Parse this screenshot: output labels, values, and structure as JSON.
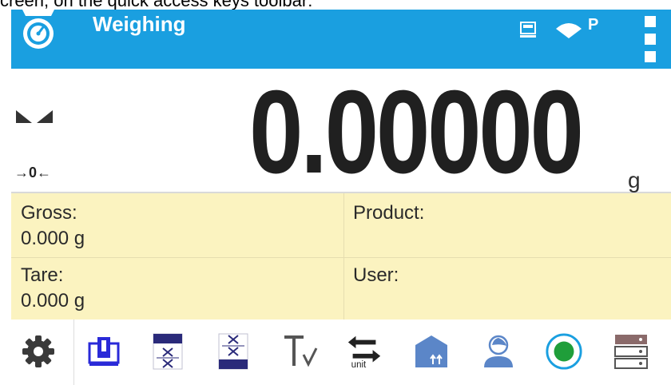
{
  "caption": "creen, on the quick access keys toolbar:",
  "titlebar": {
    "title": "Weighing",
    "icons": [
      "scale-app-icon",
      "pc-connection-icon",
      "wifi-icon",
      "menu-icon"
    ],
    "profile_letter": "P",
    "background": "#1a9fe0"
  },
  "display": {
    "weight": "0.00000",
    "unit": "g",
    "zero_indicator": "→0←",
    "stability_icon": "stable-indicator-icon"
  },
  "info": {
    "gross_label": "Gross:",
    "gross_value": "0.000 g",
    "product_label": "Product:",
    "tare_label": "Tare:",
    "tare_value": "0.000 g",
    "user_label": "User:",
    "background": "#fbf3c0"
  },
  "toolbar": {
    "unit_label": "unit",
    "keys": [
      "settings-icon",
      "tare-icon",
      "print-header-icon",
      "print-footer-icon",
      "text-edit-icon",
      "unit-change-icon",
      "product-icon",
      "user-icon",
      "record-icon",
      "database-icon"
    ],
    "accent": "#1a9fe0"
  }
}
